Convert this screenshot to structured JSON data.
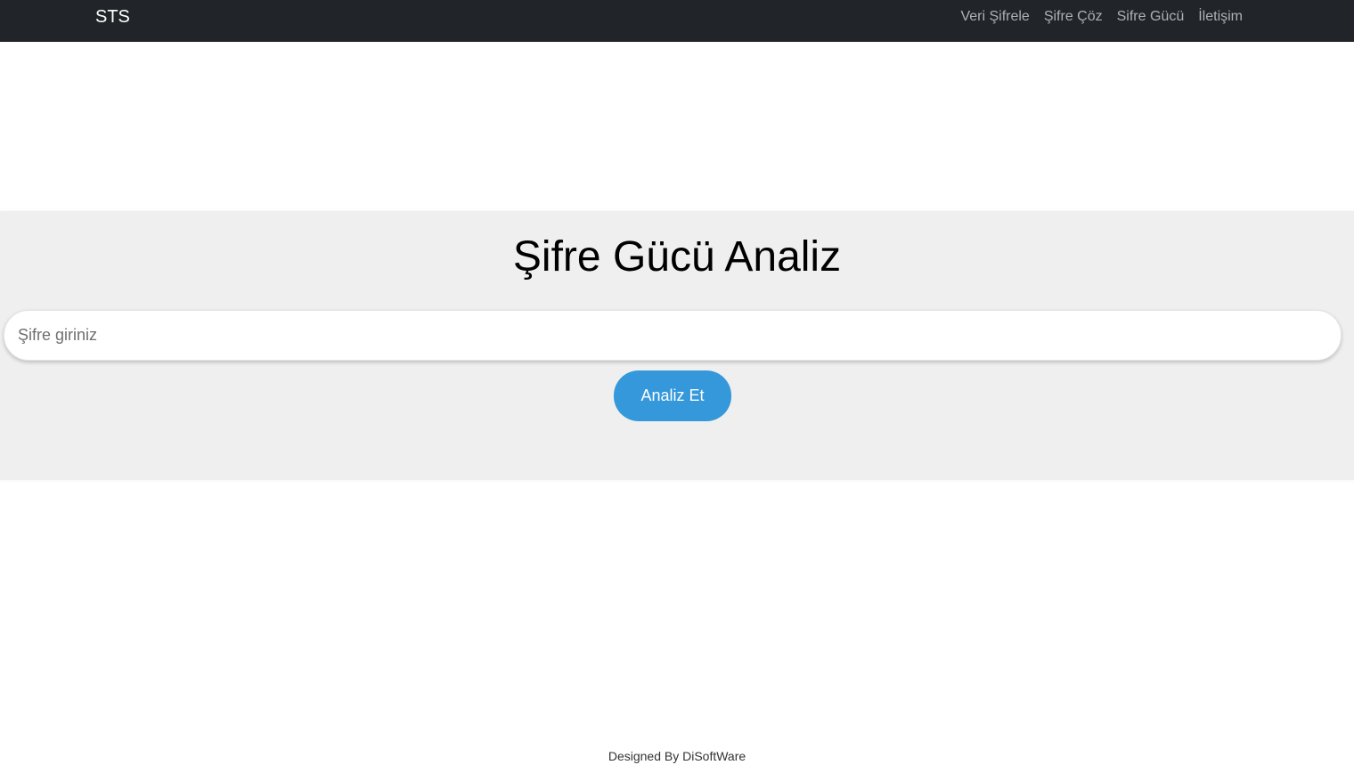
{
  "navbar": {
    "brand": "STS",
    "links": [
      {
        "label": "Veri Şifrele"
      },
      {
        "label": "Şifre Çöz"
      },
      {
        "label": "Sifre Gücü"
      },
      {
        "label": "İletişim"
      }
    ]
  },
  "main": {
    "title": "Şifre Gücü Analiz",
    "password_input": {
      "placeholder": "Şifre giriniz",
      "value": ""
    },
    "analyze_button_label": "Analiz Et"
  },
  "footer": {
    "text": "Designed By DiSoftWare"
  },
  "colors": {
    "navbar_bg": "#212529",
    "hero_bg": "#efefef",
    "button_bg": "#3498db"
  }
}
